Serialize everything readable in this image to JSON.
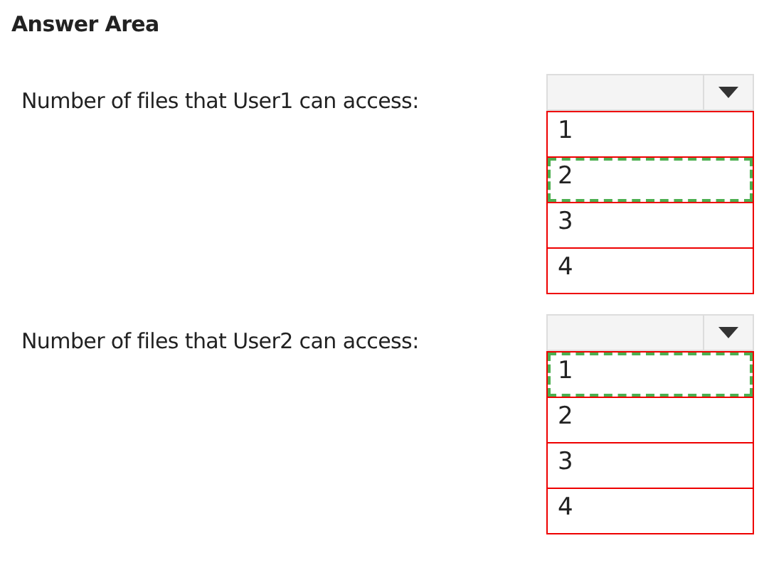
{
  "title": "Answer Area",
  "questions": [
    {
      "label": "Number of files that User1 can access:",
      "options": [
        {
          "label": "1",
          "selected": false
        },
        {
          "label": "2",
          "selected": true
        },
        {
          "label": "3",
          "selected": false
        },
        {
          "label": "4",
          "selected": false
        }
      ]
    },
    {
      "label": "Number of files that User2 can access:",
      "options": [
        {
          "label": "1",
          "selected": true
        },
        {
          "label": "2",
          "selected": false
        },
        {
          "label": "3",
          "selected": false
        },
        {
          "label": "4",
          "selected": false
        }
      ]
    }
  ]
}
